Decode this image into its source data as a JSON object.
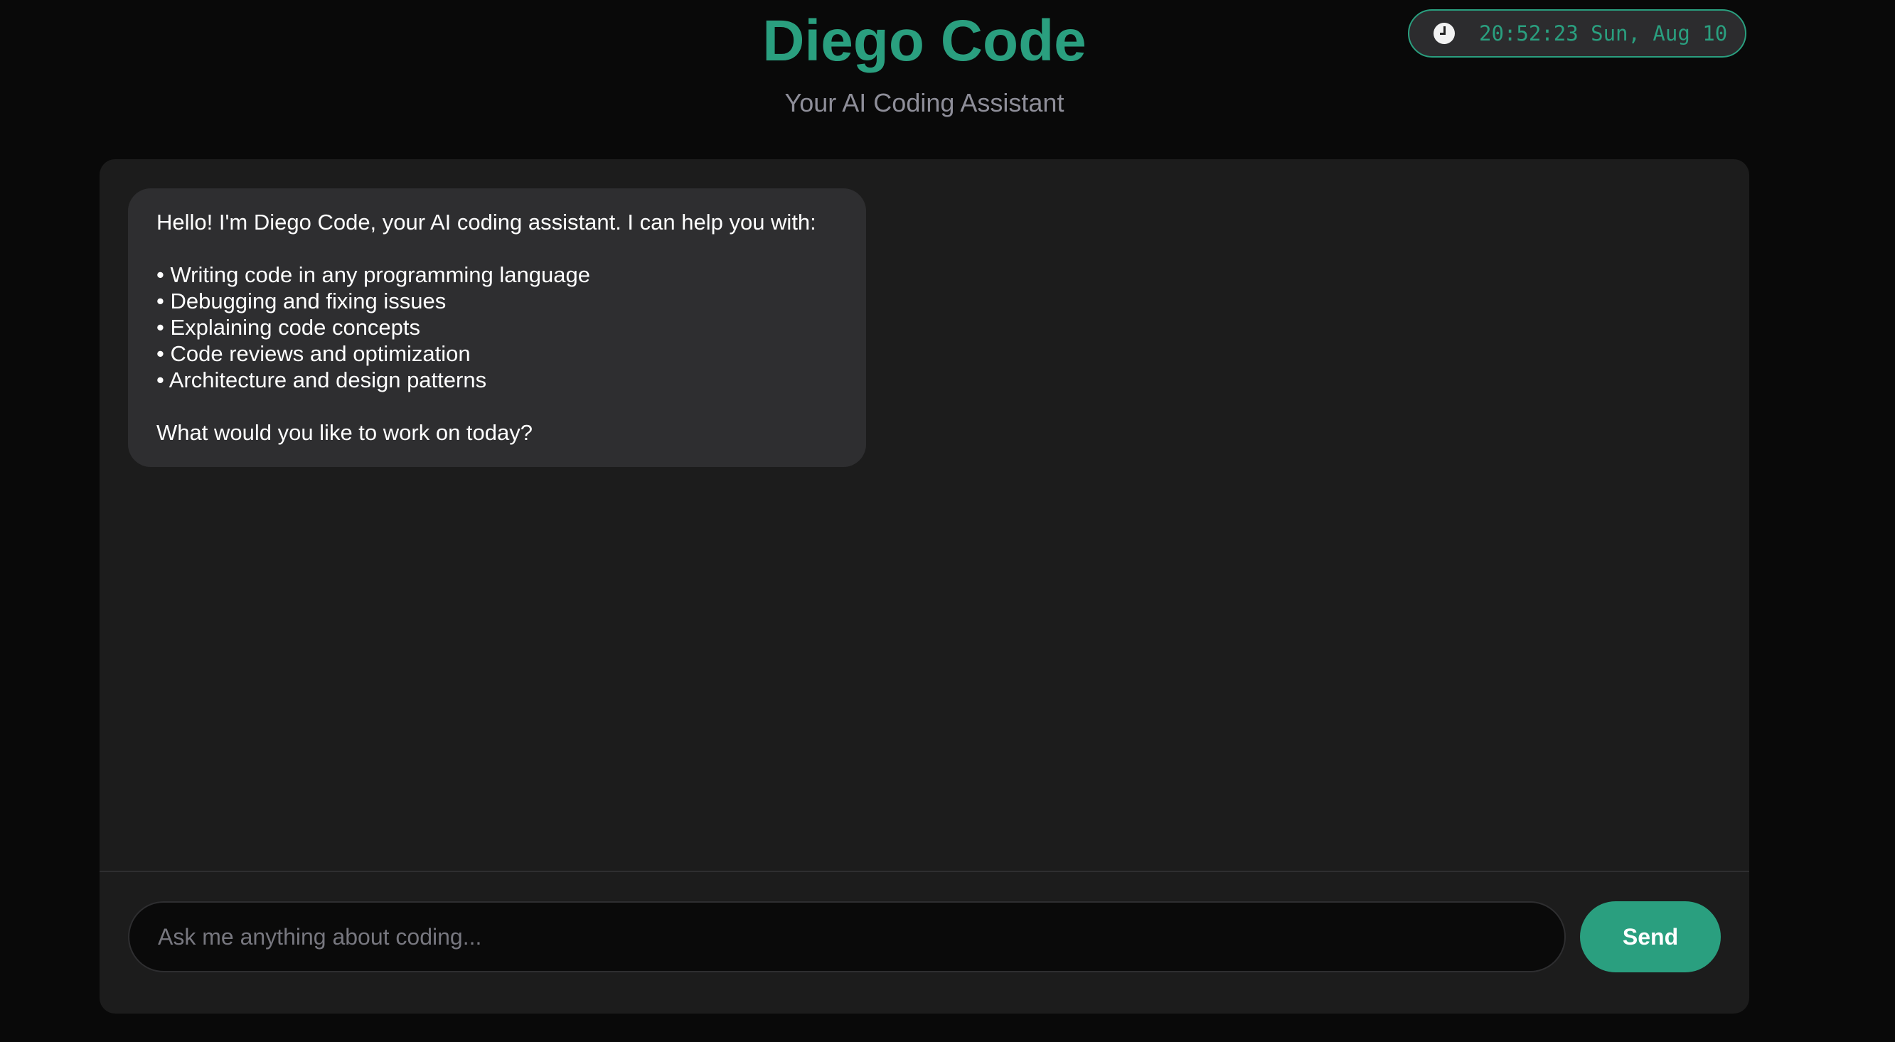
{
  "header": {
    "title": "Diego Code",
    "subtitle": "Your AI Coding Assistant"
  },
  "clock": {
    "icon": "clock-icon",
    "text": "20:52:23 Sun, Aug 10"
  },
  "messages": [
    {
      "sender": "assistant",
      "intro": "Hello! I'm Diego Code, your AI coding assistant. I can help you with:",
      "items": [
        "• Writing code in any programming language",
        "• Debugging and fixing issues",
        "• Explaining code concepts",
        "• Code reviews and optimization",
        "• Architecture and design patterns"
      ],
      "outro": "What would you like to work on today?"
    }
  ],
  "composer": {
    "placeholder": "Ask me anything about coding...",
    "value": "",
    "send_label": "Send"
  },
  "colors": {
    "accent": "#2a9f7f",
    "background": "#090909",
    "panel": "#1c1c1c",
    "bubble": "#2e2e30"
  }
}
